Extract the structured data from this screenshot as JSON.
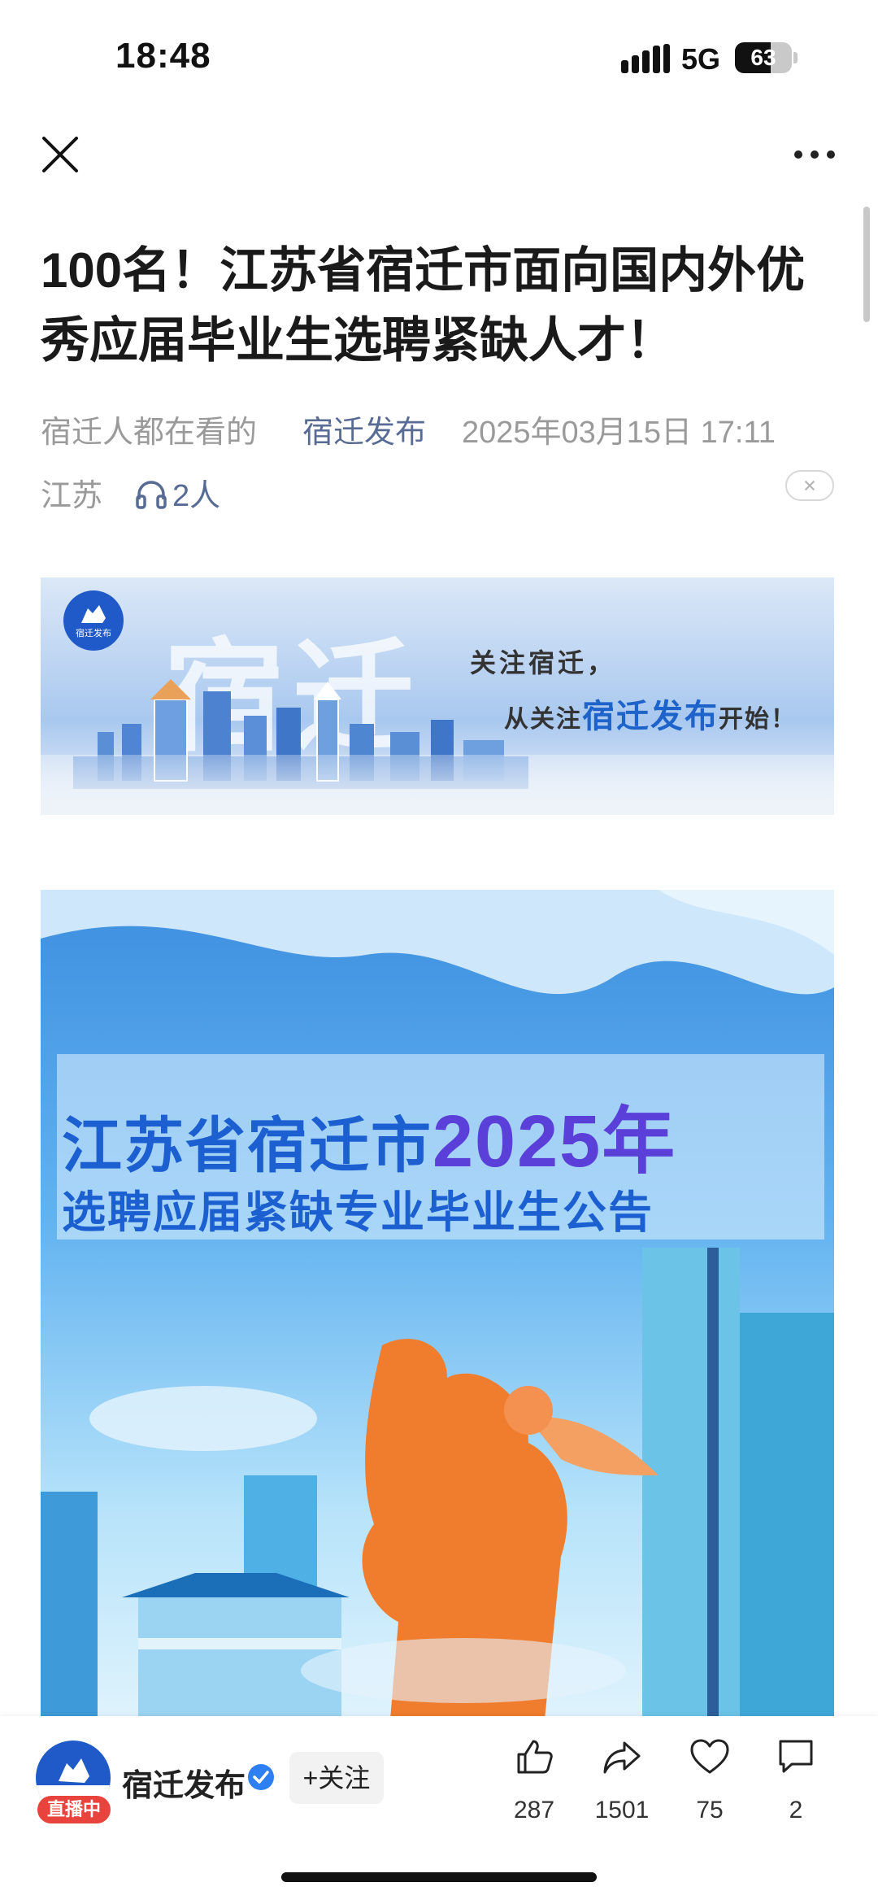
{
  "status_bar": {
    "time": "18:48",
    "network": "5G",
    "battery_percent": "63",
    "battery_level": 0.63
  },
  "nav": {
    "close_icon": "close-icon",
    "more_icon": "more-dots-icon"
  },
  "article": {
    "title": "100名！江苏省宿迁市面向国内外优秀应届毕业生选聘紧缺人才！",
    "meta_tag": "宿迁人都在看的",
    "account": "宿迁发布",
    "date": "2025年03月15日 17:11",
    "region": "江苏",
    "listeners": "2人"
  },
  "banner": {
    "logo_text": "宿迁发布",
    "watermark": "宿迁",
    "slogan_line1": "关注宿迁，",
    "slogan_line2_prefix": "从关注",
    "slogan_line2_highlight": "宿迁发布",
    "slogan_line2_suffix": "开始！"
  },
  "poster": {
    "title_line1_prefix": "江苏省宿迁市",
    "title_line1_year": "2025年",
    "title_line2": "选聘应届紧缺专业毕业生公告"
  },
  "bottom_bar": {
    "account_name": "宿迁发布",
    "live_badge": "直播中",
    "follow_label": "+关注",
    "likes": "287",
    "shares": "1501",
    "favorites": "75",
    "comments": "2"
  }
}
